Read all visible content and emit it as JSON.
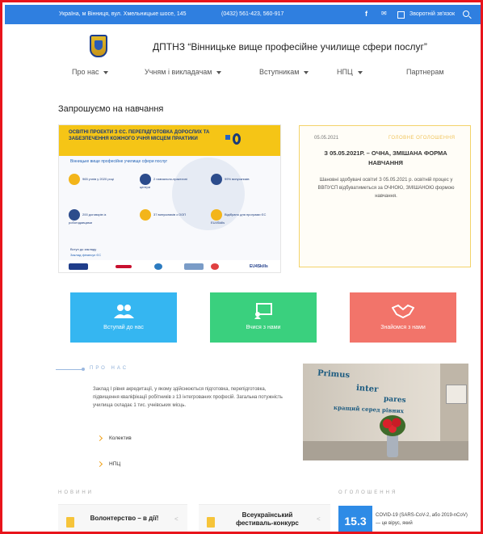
{
  "topbar": {
    "address": "Україна, м Вінниця, вул. Хмельницьке шосе, 145",
    "phone": "(0432) 561-423, 560-917",
    "feedback": "Зворотній зв'язок"
  },
  "header": {
    "title": "ДПТНЗ “Вінницьке вище професійне училище сфери послуг”"
  },
  "nav": [
    {
      "label": "Про нас"
    },
    {
      "label": "Учням і викладачам"
    },
    {
      "label": "Вступникам"
    },
    {
      "label": "НПЦ"
    },
    {
      "label": "Партнерам"
    }
  ],
  "main": {
    "section_title": "Запрошуємо на навчання",
    "banner": {
      "headline": "ОСВІТНІ ПРОЕКТИ З ЄС. ПЕРЕПІДГОТОВКА ДОРОСЛИХ ТА ЗАБЕЗПЕЧЕННЯ КОЖНОГО УЧНЯ МІСЦЕМ ПРАКТИКИ",
      "subtitle": "Вінницьке вище професійне училище сфери послуг",
      "stats": [
        "965 учнів у 2020 році",
        "2 навчально-практичні центри",
        "99% випускників",
        "200 договорів із роботодавцями",
        "37 випускників з ООП",
        "Відібрано для програми ЄС EU4Skills"
      ],
      "foot_text": "Вступ до закладу",
      "foot_link": "Заклад фінансує ЄС",
      "logo_text": "EU4Skills"
    },
    "announcement": {
      "date": "05.05.2021",
      "tag": "ГОЛОВНЕ ОГОЛОШЕННЯ",
      "title": "З 05.05.2021Р. – ОЧНА, ЗМІШАНА ФОРМА НАВЧАННЯ",
      "body": "Шановні здобувачі освіти! З 05.05.2021 р. освітній процес у ВВПУСП відбуватиметься за ОЧНОЮ, ЗМІШАНОЮ формою навчання."
    },
    "tiles": [
      {
        "label": "Вступай до нас",
        "color": "#35b6f1"
      },
      {
        "label": "Вчися з нами",
        "color": "#3ad07e"
      },
      {
        "label": "Знайомся з нами",
        "color": "#f2746a"
      }
    ],
    "about": {
      "title": "ПРО НАС",
      "text": "Заклад І рівня акредитації, у якому здійснюються підготовка, перепідготовка, підвищення кваліфікації робітників з 13 інтегрованих професій. Загальна потужність училища складає 1 тис. учнівських місць.",
      "links": [
        "Колектив",
        "НПЦ"
      ]
    },
    "photo_words": [
      "Primus",
      "inter",
      "pares",
      "кращий серед рівних"
    ]
  },
  "bottom": {
    "news_label": "НОВИНИ",
    "ann_label": "ОГОЛОШЕННЯ",
    "news": [
      {
        "title": "Волонтерство – в дії!"
      },
      {
        "title": "Всеукраїнський фестиваль-конкурс"
      }
    ],
    "ann_date": "15.3",
    "ann_snippet": "COVID-19 (SARS-CoV-2, або 2019-nCoV) — це вірус, який"
  },
  "colors": {
    "topbar": "#2f7fe0",
    "frame": "#e8141b",
    "banner_yellow": "#f5c516",
    "accent": "#f0a11a"
  }
}
